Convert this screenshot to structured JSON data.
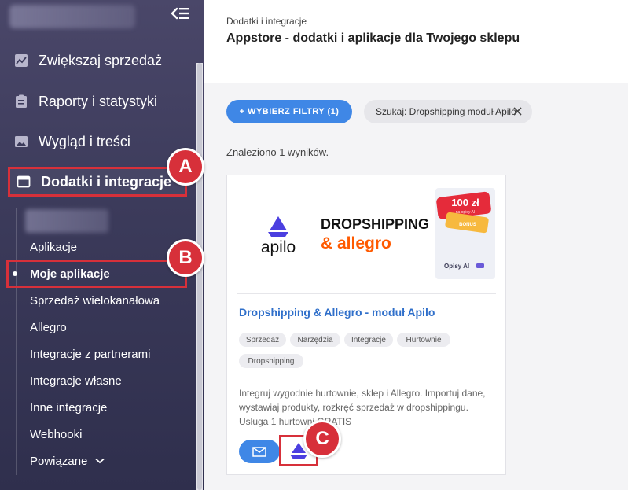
{
  "sidebar": {
    "menu": [
      {
        "label": "Zwiększaj sprzedaż",
        "icon": "chart-icon"
      },
      {
        "label": "Raporty i statystyki",
        "icon": "clipboard-icon"
      },
      {
        "label": "Wygląd i treści",
        "icon": "image-icon"
      },
      {
        "label": "Dodatki i integracje",
        "icon": "window-icon"
      }
    ],
    "submenu": [
      "Aplikacje",
      "Moje aplikacje",
      "Sprzedaż wielokanałowa",
      "Allegro",
      "Integracje z partnerami",
      "Integracje własne",
      "Inne integracje",
      "Webhooki",
      "Powiązane"
    ]
  },
  "badges": {
    "a": "A",
    "b": "B",
    "c": "C"
  },
  "header": {
    "breadcrumb": "Dodatki i integracje",
    "title": "Appstore - dodatki i aplikacje dla Twojego sklepu"
  },
  "filters": {
    "button_label": "+ WYBIERZ FILTRY (1)",
    "search_chip": "Szukaj: Dropshipping moduł Apilo"
  },
  "results_text": "Znaleziono 1 wyników.",
  "card": {
    "banner": {
      "logo_text": "apilo",
      "headline_1": "DROPSHIPPING",
      "headline_2": "& allegro",
      "price": "100 zł",
      "price_sub": "na opisy AI",
      "bonus": "BONUS",
      "footer": "Opisy AI"
    },
    "title": "Dropshipping & Allegro - moduł Apilo",
    "tags": [
      "Sprzedaż",
      "Narzędzia",
      "Integracje",
      "Hurtownie",
      "Dropshipping"
    ],
    "description": "Integruj wygodnie hurtownie, sklep i Allegro. Importuj dane, wystawiaj produkty, rozkręć sprzedaż w dropshippingu. Usługa 1 hurtowni GRATIS"
  },
  "colors": {
    "accent_blue": "#3f87e6",
    "highlight_red": "#d7303a",
    "sidebar_bg": "#3b3a5a",
    "apilo_purple": "#4b3fe0",
    "allegro_orange": "#ff5a00"
  }
}
